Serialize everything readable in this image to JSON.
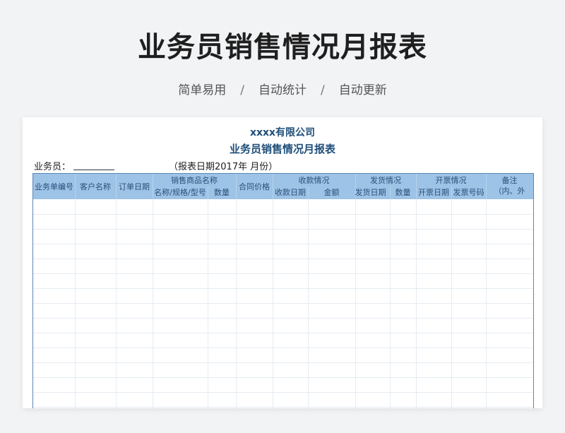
{
  "hero": {
    "title": "业务员销售情况月报表",
    "features": [
      "简单易用",
      "自动统计",
      "自动更新"
    ],
    "separator": "/"
  },
  "sheet": {
    "company": "xxxx有限公司",
    "title": "业务员销售情况月报表",
    "salesman_label": "业务员：",
    "report_date": "（报表日期2017年   月份）",
    "headers": {
      "order_no": "业务单编号",
      "customer": "客户名称",
      "order_date": "订单日期",
      "goods_group": "销售商品名称",
      "goods_spec": "名称/规格/型号",
      "goods_qty": "数量",
      "contract_price": "合同价格",
      "receipt_group": "收款情况",
      "receipt_date": "收款日期",
      "receipt_amount": "金额",
      "ship_group": "发货情况",
      "ship_date": "发货日期",
      "ship_qty": "数量",
      "invoice_group": "开票情况",
      "invoice_date": "开票日期",
      "invoice_no": "发票号码",
      "remark": "备注",
      "remark_sub": "（内、外"
    },
    "colors": {
      "header_bg": "#9dc3e6",
      "header_text": "#2c4f7a",
      "title_text": "#1f4e79",
      "border": "#5b86b7"
    }
  }
}
